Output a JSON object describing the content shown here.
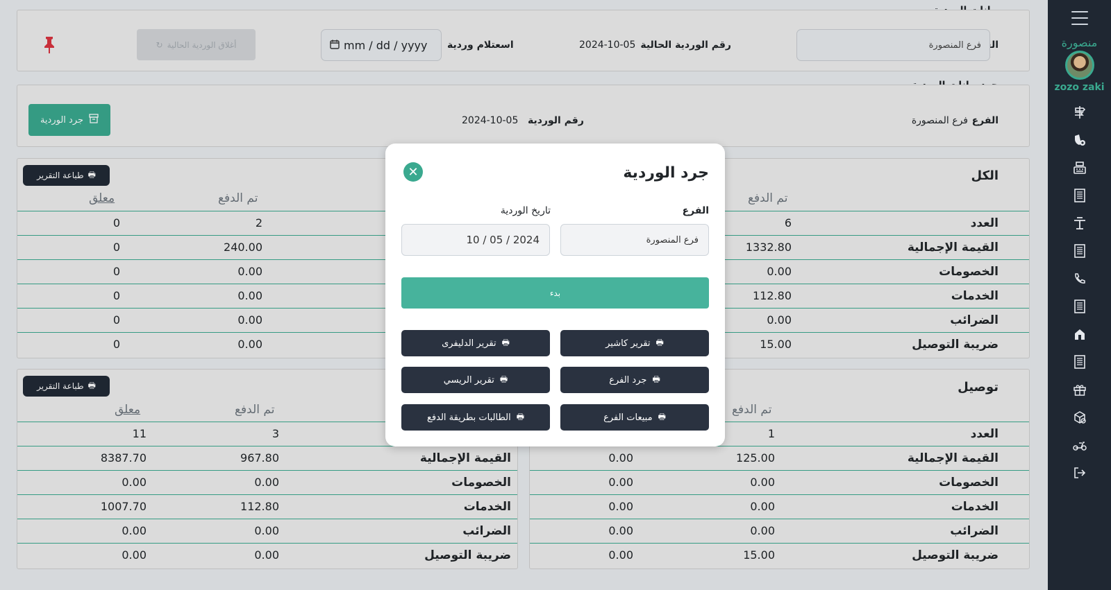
{
  "sidebar": {
    "brand": "منصورة",
    "username": "zozo zaki",
    "icons": [
      "signpost-icon",
      "shield-icon",
      "cash-register-icon",
      "receipt-icon",
      "table-icon",
      "receipt-icon",
      "phone-icon",
      "receipt-icon",
      "store-icon",
      "receipt-icon",
      "gift-icon",
      "box-icon",
      "scooter-icon",
      "logout-icon"
    ]
  },
  "shift_data": {
    "title": "بيانات الوردية",
    "branch_label": "الفرع",
    "branch_value": "فرع المنصورة",
    "current_shift_label": "رقم الوردية الحالية",
    "current_shift_value": "2024-10-05",
    "inquiry_label": "اسعتلام وردية",
    "date_placeholder": "mm / dd / yyyy",
    "close_shift_button": "أغلاق الوردية الحالية"
  },
  "inventory": {
    "title": "جرد بيانات الوردية",
    "branch_label": "الفرع",
    "branch_value": "فرع المنصورة",
    "shift_label": "رقم الوردية",
    "shift_value": "2024-10-05",
    "button": "جرد الوردية"
  },
  "print_button": "طباعة التقرير",
  "all_section": {
    "title": "الكل",
    "right_header": "تم الدفع",
    "left_headers": [
      "تم الدفع",
      "معلق"
    ],
    "rows": [
      {
        "label": "العدد",
        "right": "6",
        "paid": "2",
        "pending": "0"
      },
      {
        "label": "القيمة الإجمالية",
        "right": "1332.80",
        "paid": "240.00",
        "pending": "0"
      },
      {
        "label": "الخصومات",
        "right": "0.00",
        "paid": "0.00",
        "pending": "0"
      },
      {
        "label": "الخدمات",
        "right": "112.80",
        "paid": "0.00",
        "pending": "0"
      },
      {
        "label": "الضرائب",
        "right": "0.00",
        "paid": "0.00",
        "pending": "0"
      },
      {
        "label": "ضريبة التوصيل",
        "right": "15.00",
        "paid": "0.00",
        "pending": "0"
      }
    ]
  },
  "delivery_section": {
    "title": "توصيل",
    "right_header": "تم الدفع",
    "left_headers": [
      "تم الدفع",
      "معلق"
    ],
    "rows": [
      {
        "label": "العدد",
        "a": "",
        "b": "1",
        "paid": "3",
        "pending": "11"
      },
      {
        "label": "القيمة الإجمالية",
        "a": "0.00",
        "b": "125.00",
        "paid": "967.80",
        "pending": "8387.70"
      },
      {
        "label": "الخصومات",
        "a": "0.00",
        "b": "0.00",
        "paid": "0.00",
        "pending": "0.00"
      },
      {
        "label": "الخدمات",
        "a": "0.00",
        "b": "0.00",
        "paid": "112.80",
        "pending": "1007.70"
      },
      {
        "label": "الضرائب",
        "a": "0.00",
        "b": "0.00",
        "paid": "0.00",
        "pending": "0.00"
      },
      {
        "label": "ضريبة التوصيل",
        "a": "0.00",
        "b": "15.00",
        "paid": "0.00",
        "pending": "0.00"
      }
    ]
  },
  "modal": {
    "title": "جرد الوردية",
    "branch_label": "الفرع",
    "branch_value": "فرع المنصورة",
    "date_label": "تاريخ الوردية",
    "date_value": "10 / 05 / 2024",
    "start_button": "بدء",
    "reports": [
      "تقرير كاشير",
      "تقرير الدليفرى",
      "جرد الفرع",
      "تقرير الريسي",
      "مبيعات الفرع",
      "الطالبات بطريقة الدفع"
    ]
  },
  "colors": {
    "accent": "#3aa98f",
    "sidebar": "#1f2732",
    "dark_button": "#2a3240"
  }
}
